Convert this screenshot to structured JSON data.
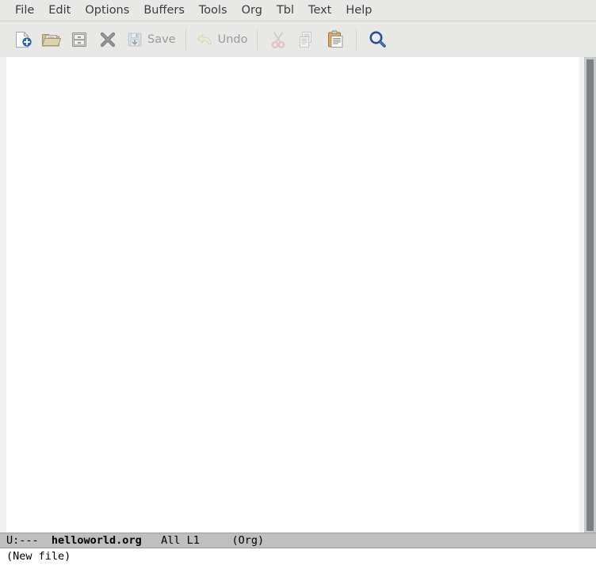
{
  "window": {
    "application": "Emacs",
    "buffer_name": "helloworld.org"
  },
  "menubar": {
    "items": [
      {
        "label": "File",
        "name": "menu-file"
      },
      {
        "label": "Edit",
        "name": "menu-edit"
      },
      {
        "label": "Options",
        "name": "menu-options"
      },
      {
        "label": "Buffers",
        "name": "menu-buffers"
      },
      {
        "label": "Tools",
        "name": "menu-tools"
      },
      {
        "label": "Org",
        "name": "menu-org"
      },
      {
        "label": "Tbl",
        "name": "menu-tbl"
      },
      {
        "label": "Text",
        "name": "menu-text"
      },
      {
        "label": "Help",
        "name": "menu-help"
      }
    ]
  },
  "toolbar": {
    "new_file_icon": "new-file-icon",
    "open_file_icon": "open-folder-icon",
    "save_as_icon": "save-as-cabinet-icon",
    "close_icon": "close-x-icon",
    "save_icon": "save-floppy-icon",
    "save_label": "Save",
    "undo_icon": "undo-arrow-icon",
    "undo_label": "Undo",
    "cut_icon": "cut-scissors-icon",
    "copy_icon": "copy-documents-icon",
    "paste_icon": "paste-clipboard-icon",
    "search_icon": "search-magnifier-icon"
  },
  "buffer": {
    "content": ""
  },
  "modeline": {
    "status": "U:---",
    "gap1": "  ",
    "buffer_name": "helloworld.org",
    "gap2": "   ",
    "position": "All L1",
    "gap3": "     ",
    "major_mode": "(Org)"
  },
  "echo": {
    "message": "(New file)"
  },
  "scrollbar": {
    "thumb_top_percent": 0,
    "thumb_height_percent": 100
  },
  "colors": {
    "chrome_bg": "#e8e8e7",
    "buffer_bg": "#ffffff",
    "modeline_bg": "#bfbfbf",
    "fringe_bg": "#f1f1f1",
    "scrollbar_track": "#c6c9c9",
    "scrollbar_thumb": "#7d8082",
    "menu_text": "#3c3c3c",
    "disabled_text": "#9b9b9b"
  }
}
